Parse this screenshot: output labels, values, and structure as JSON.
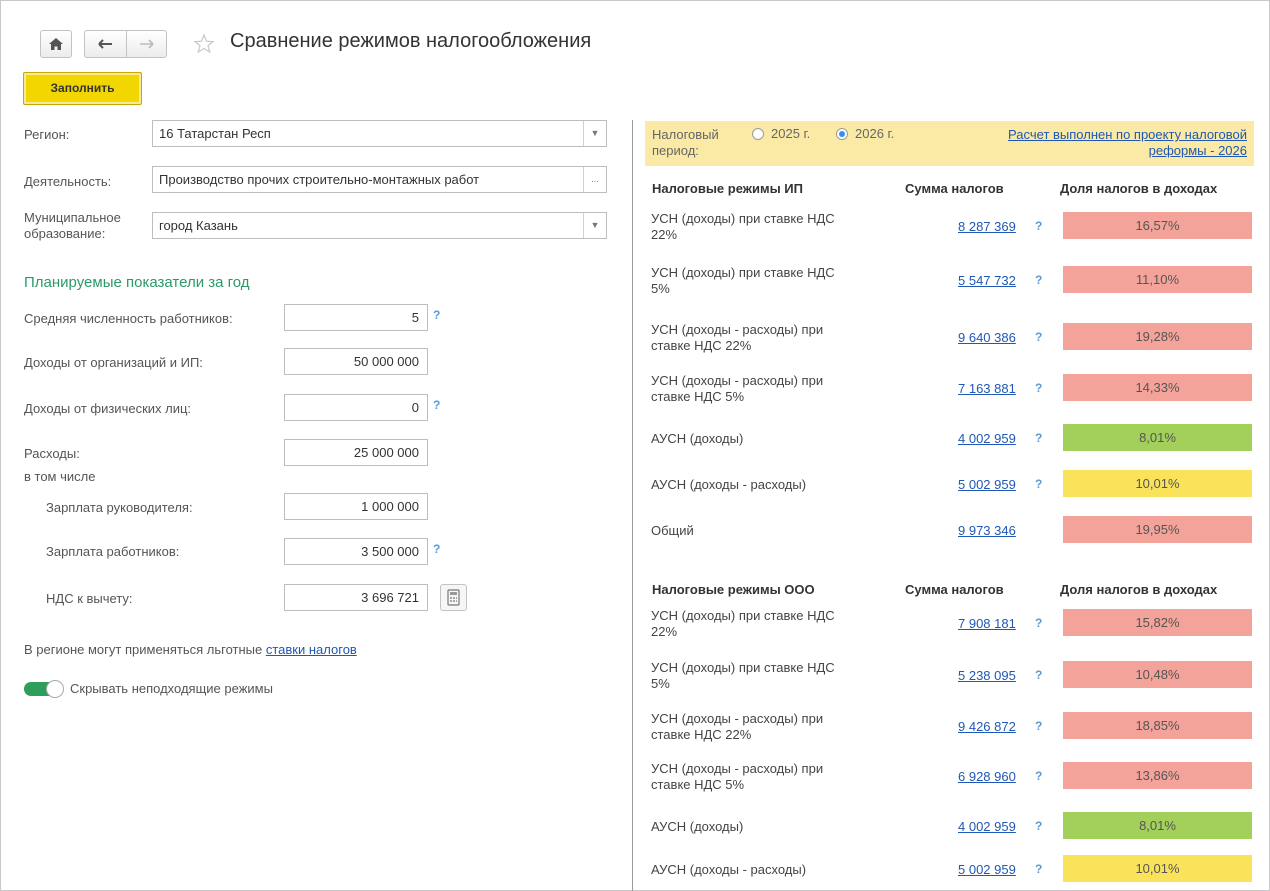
{
  "window": {
    "title": "Сравнение режимов налогообложения"
  },
  "toolbar": {
    "fill_label": "Заполнить"
  },
  "form": {
    "region": {
      "label": "Регион:",
      "value": "16 Татарстан Респ"
    },
    "activity": {
      "label": "Деятельность:",
      "value": "Производство прочих строительно-монтажных работ"
    },
    "municipality": {
      "label_line1": "Муниципальное",
      "label_line2": "образование:",
      "value": "город Казань"
    },
    "section_title": "Планируемые показатели за год",
    "employees": {
      "label": "Средняя численность работников:",
      "value": "5"
    },
    "income_org": {
      "label": "Доходы от организаций и ИП:",
      "value": "50 000 000"
    },
    "income_phys": {
      "label": "Доходы от физических лиц:",
      "value": "0"
    },
    "expenses": {
      "label": "Расходы:",
      "value": "25 000 000"
    },
    "including": "в том числе",
    "salary_head": {
      "label": "Зарплата руководителя:",
      "value": "1 000 000"
    },
    "salary_staff": {
      "label": "Зарплата работников:",
      "value": "3 500 000"
    },
    "vat_deduct": {
      "label": "НДС к вычету:",
      "value": "3 696 721"
    },
    "benefits_text": "В регионе могут применяться льготные",
    "benefits_link": "ставки налогов",
    "hide_toggle_label": "Скрывать неподходящие режимы",
    "hide_toggle_on": true
  },
  "period": {
    "label_line1": "Налоговый",
    "label_line2": "период:",
    "option1": "2025 г.",
    "option2": "2026 г.",
    "selected": "2026 г.",
    "note_line1": "Расчет выполнен по проекту налоговой",
    "note_line2": "реформы - 2026"
  },
  "ip": {
    "header": "Налоговые режимы ИП",
    "sum_header": "Сумма налогов",
    "share_header": "Доля налогов в доходах",
    "rows": [
      {
        "name1": "УСН (доходы) при ставке НДС",
        "name2": "22%",
        "sum": "8 287 369",
        "share": "16,57%",
        "color": "#f4a39a",
        "help": true
      },
      {
        "name1": "УСН (доходы) при ставке НДС",
        "name2": "5%",
        "sum": "5 547 732",
        "share": "11,10%",
        "color": "#f4a39a",
        "help": true
      },
      {
        "name1": "УСН (доходы - расходы) при",
        "name2": "ставке НДС 22%",
        "sum": "9 640 386",
        "share": "19,28%",
        "color": "#f4a39a",
        "help": true
      },
      {
        "name1": "УСН (доходы - расходы) при",
        "name2": "ставке НДС 5%",
        "sum": "7 163 881",
        "share": "14,33%",
        "color": "#f4a39a",
        "help": true
      },
      {
        "name1": "АУСН (доходы)",
        "name2": "",
        "sum": "4 002 959",
        "share": "8,01%",
        "color": "#a2d05a",
        "help": true
      },
      {
        "name1": "АУСН (доходы - расходы)",
        "name2": "",
        "sum": "5 002 959",
        "share": "10,01%",
        "color": "#fae35a",
        "help": true
      },
      {
        "name1": "Общий",
        "name2": "",
        "sum": "9 973 346",
        "share": "19,95%",
        "color": "#f4a39a",
        "help": false
      }
    ]
  },
  "ooo": {
    "header": "Налоговые режимы ООО",
    "sum_header": "Сумма налогов",
    "share_header": "Доля налогов в доходах",
    "rows": [
      {
        "name1": "УСН (доходы) при ставке НДС",
        "name2": "22%",
        "sum": "7 908 181",
        "share": "15,82%",
        "color": "#f4a39a",
        "help": true
      },
      {
        "name1": "УСН (доходы) при ставке НДС",
        "name2": "5%",
        "sum": "5 238 095",
        "share": "10,48%",
        "color": "#f4a39a",
        "help": true
      },
      {
        "name1": "УСН (доходы - расходы) при",
        "name2": "ставке НДС 22%",
        "sum": "9 426 872",
        "share": "18,85%",
        "color": "#f4a39a",
        "help": true
      },
      {
        "name1": "УСН (доходы - расходы) при",
        "name2": "ставке НДС 5%",
        "sum": "6 928 960",
        "share": "13,86%",
        "color": "#f4a39a",
        "help": true
      },
      {
        "name1": "АУСН (доходы)",
        "name2": "",
        "sum": "4 002 959",
        "share": "8,01%",
        "color": "#a2d05a",
        "help": true
      },
      {
        "name1": "АУСН (доходы - расходы)",
        "name2": "",
        "sum": "5 002 959",
        "share": "10,01%",
        "color": "#fae35a",
        "help": true
      }
    ]
  },
  "icons": {
    "home": "home-icon",
    "back": "arrow-left-icon",
    "forward": "arrow-right-icon",
    "favorite": "star-icon",
    "help": "question-icon",
    "calculator": "calculator-icon"
  }
}
